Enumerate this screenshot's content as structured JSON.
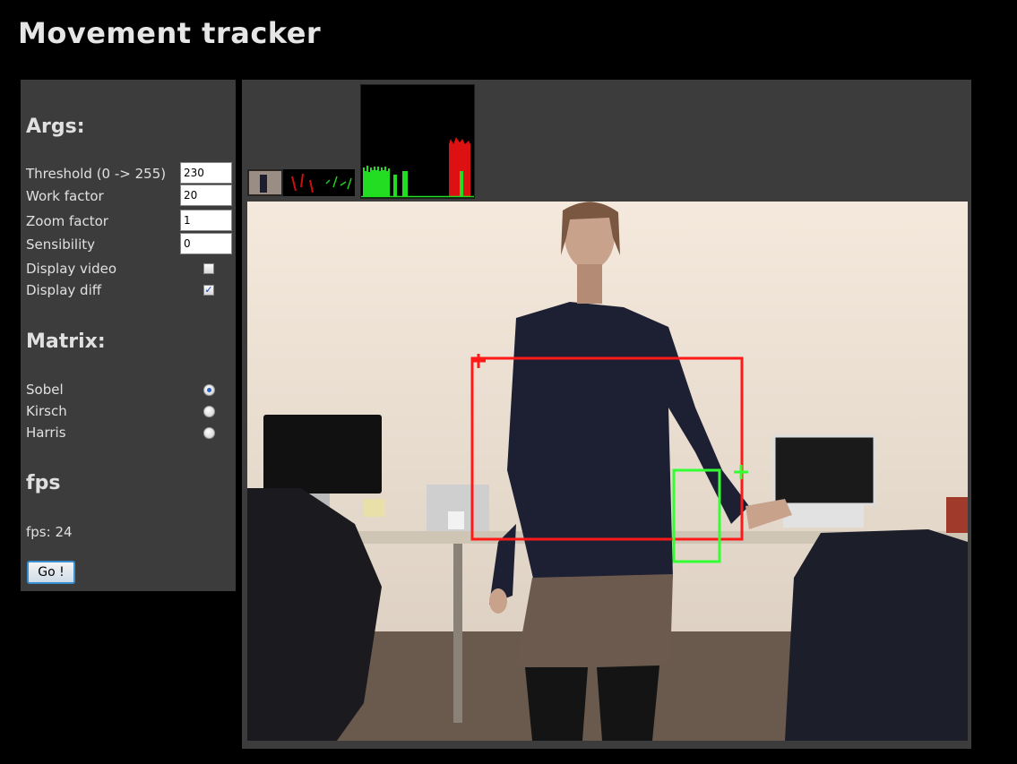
{
  "page": {
    "title": "Movement tracker"
  },
  "args": {
    "heading": "Args:",
    "threshold_label": "Threshold (0 -> 255)",
    "threshold_value": "230",
    "work_factor_label": "Work factor",
    "work_factor_value": "20",
    "zoom_factor_label": "Zoom factor",
    "zoom_factor_value": "1",
    "sensibility_label": "Sensibility",
    "sensibility_value": "0",
    "display_video_label": "Display video",
    "display_video_checked": false,
    "display_diff_label": "Display diff",
    "display_diff_checked": true
  },
  "matrix": {
    "heading": "Matrix:",
    "options": [
      {
        "label": "Sobel",
        "selected": true
      },
      {
        "label": "Kirsch",
        "selected": false
      },
      {
        "label": "Harris",
        "selected": false
      }
    ]
  },
  "fps": {
    "heading": "fps",
    "text": "fps: 24"
  },
  "go_button": {
    "label": "Go !"
  },
  "colors": {
    "background": "#000000",
    "panel": "#3c3c3c",
    "tracker_red": "#ff1a1a",
    "tracker_green": "#33ff33"
  }
}
